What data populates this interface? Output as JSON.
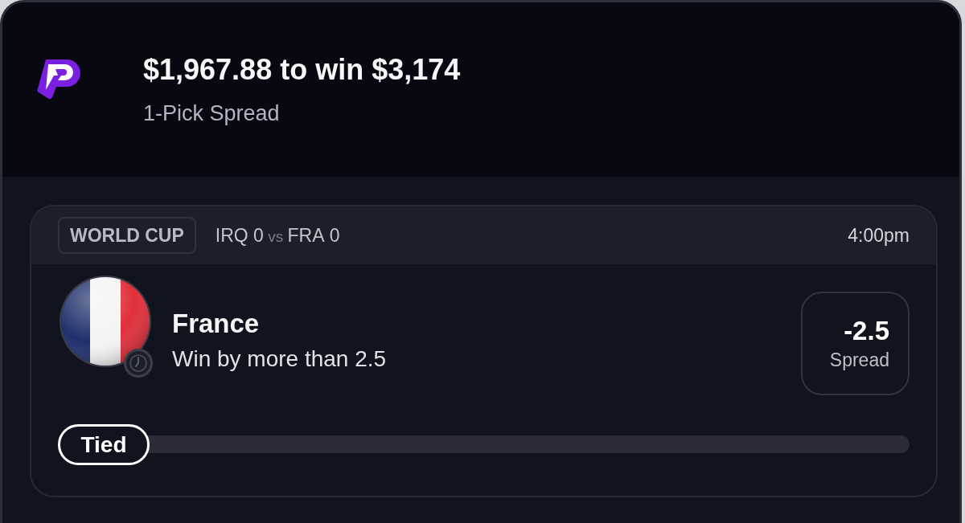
{
  "bet": {
    "title": "$1,967.88 to win $3,174",
    "subtitle": "1-Pick Spread"
  },
  "match": {
    "league": "WORLD CUP",
    "teams": [
      {
        "code": "IRQ",
        "score": "0"
      },
      {
        "code": "FRA",
        "score": "0"
      }
    ],
    "separator": "vs",
    "time": "4:00pm"
  },
  "pick": {
    "team": "France",
    "description": "Win by more than 2.5",
    "line": "-2.5",
    "line_label": "Spread"
  },
  "progress": {
    "label": "Tied",
    "level": 0
  }
}
